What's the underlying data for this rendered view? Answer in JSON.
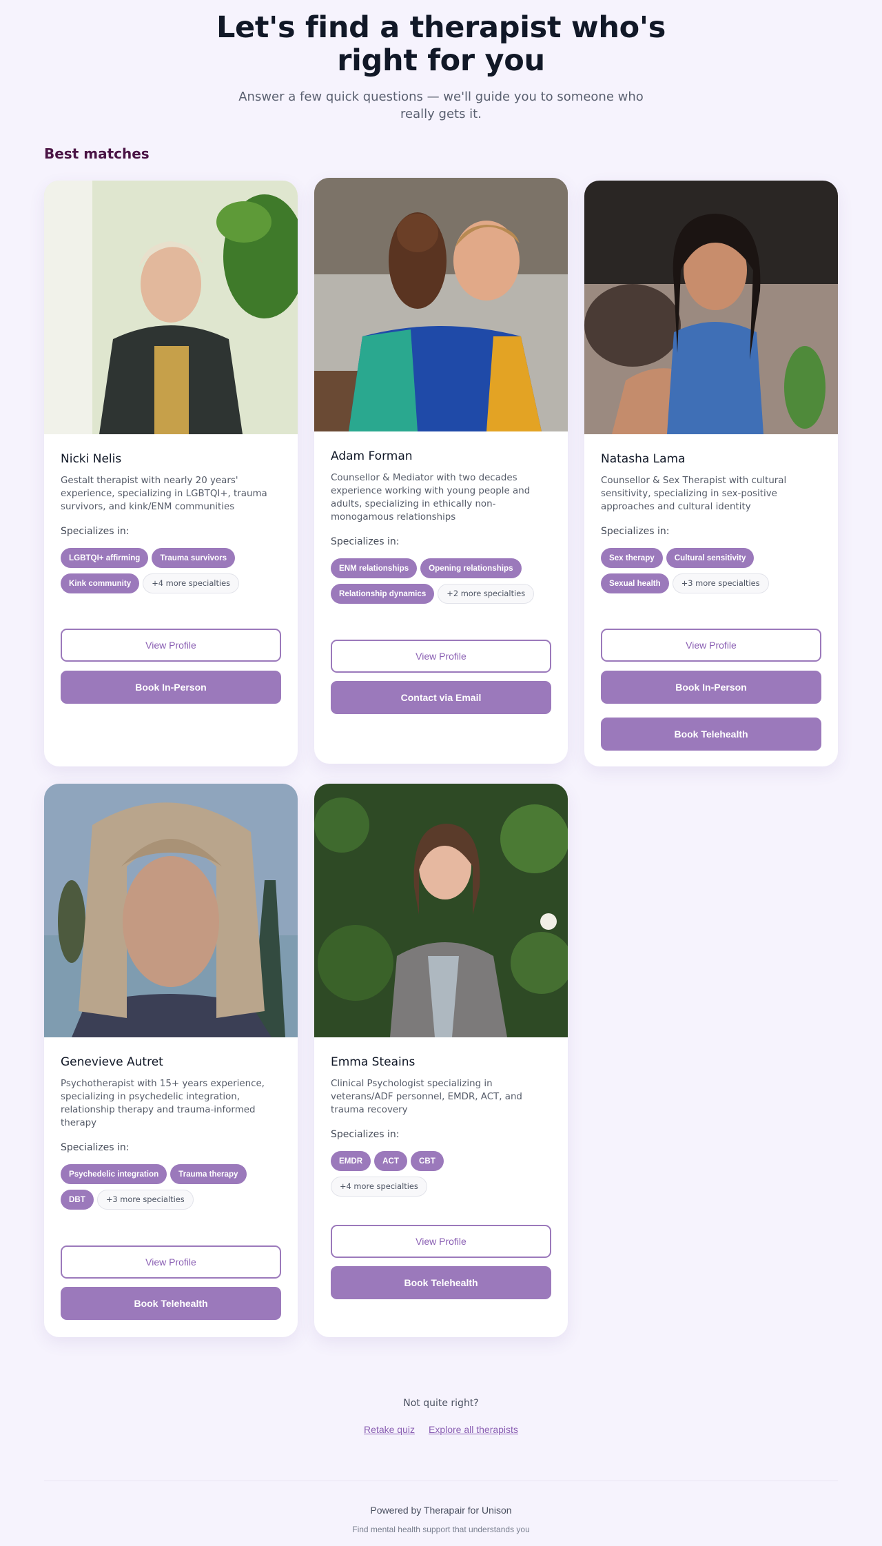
{
  "hero": {
    "title": "Let's find a therapist who's right for you",
    "subtitle": "Answer a few quick questions — we'll guide you to someone who really gets it."
  },
  "section": {
    "title": "Best matches"
  },
  "specializes_label": "Specializes in:",
  "colors": {
    "accent": "#9b79bb",
    "background": "#f6f3fd",
    "heading": "#111827"
  },
  "therapists": [
    {
      "name": "Nicki Nelis",
      "description": "Gestalt therapist with nearly 20 years' experience, specializing in LGBTQI+, trauma survivors, and kink/ENM communities",
      "tags": [
        "LGBTQI+ affirming",
        "Trauma survivors",
        "Kink community"
      ],
      "more": "+4 more specialties",
      "buttons": [
        "View Profile",
        "Book In-Person"
      ]
    },
    {
      "name": "Adam Forman",
      "description": "Counsellor & Mediator with two decades experience working with young people and adults, specializing in ethically non-monogamous relationships",
      "tags": [
        "ENM relationships",
        "Opening relationships",
        "Relationship dynamics"
      ],
      "more": "+2 more specialties",
      "buttons": [
        "View Profile",
        "Contact via Email"
      ]
    },
    {
      "name": "Natasha Lama",
      "description": "Counsellor & Sex Therapist with cultural sensitivity, specializing in sex-positive approaches and cultural identity",
      "tags": [
        "Sex therapy",
        "Cultural sensitivity",
        "Sexual health"
      ],
      "more": "+3 more specialties",
      "buttons": [
        "View Profile",
        "Book In-Person",
        "Book Telehealth"
      ]
    },
    {
      "name": "Genevieve Autret",
      "description": "Psychotherapist with 15+ years experience, specializing in psychedelic integration, relationship therapy and trauma-informed therapy",
      "tags": [
        "Psychedelic integration",
        "Trauma therapy",
        "DBT"
      ],
      "more": "+3 more specialties",
      "buttons": [
        "View Profile",
        "Book Telehealth"
      ]
    },
    {
      "name": "Emma Steains",
      "description": "Clinical Psychologist specializing in veterans/ADF personnel, EMDR, ACT, and trauma recovery",
      "tags": [
        "EMDR",
        "ACT",
        "CBT"
      ],
      "more": "+4 more specialties",
      "buttons": [
        "View Profile",
        "Book Telehealth"
      ]
    }
  ],
  "footer": {
    "question": "Not quite right?",
    "links": [
      "Retake quiz",
      "Explore all therapists"
    ],
    "powered_by": "Powered by Therapair for Unison",
    "tagline": "Find mental health support that understands you"
  }
}
